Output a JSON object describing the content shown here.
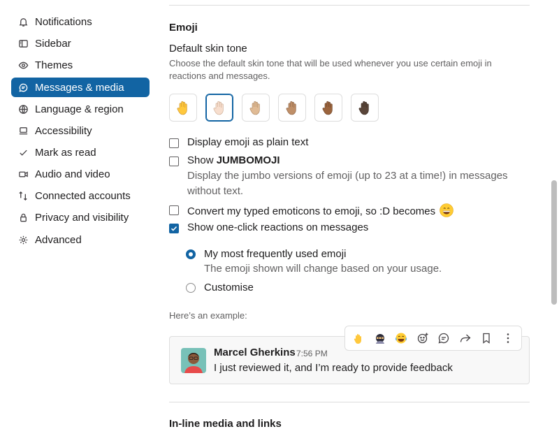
{
  "sidebar": {
    "items": [
      {
        "label": "Notifications",
        "icon": "bell-icon"
      },
      {
        "label": "Sidebar",
        "icon": "sidebar-panel-icon"
      },
      {
        "label": "Themes",
        "icon": "eye-icon"
      },
      {
        "label": "Messages & media",
        "icon": "message-icon",
        "active": true
      },
      {
        "label": "Language & region",
        "icon": "globe-icon"
      },
      {
        "label": "Accessibility",
        "icon": "laptop-icon"
      },
      {
        "label": "Mark as read",
        "icon": "check-icon"
      },
      {
        "label": "Audio and video",
        "icon": "video-icon"
      },
      {
        "label": "Connected accounts",
        "icon": "arrows-icon"
      },
      {
        "label": "Privacy and visibility",
        "icon": "lock-icon"
      },
      {
        "label": "Advanced",
        "icon": "gear-icon"
      }
    ]
  },
  "emoji": {
    "title": "Emoji",
    "skin_tone_heading": "Default skin tone",
    "skin_tone_description": "Choose the default skin tone that will be used whenever you use certain emoji in reactions and messages.",
    "skin_tones": [
      {
        "name": "default",
        "color": "#ffc83d"
      },
      {
        "name": "light",
        "color": "#f7dece",
        "selected": true
      },
      {
        "name": "medium-light",
        "color": "#e0bb95"
      },
      {
        "name": "medium",
        "color": "#bf8f68"
      },
      {
        "name": "medium-dark",
        "color": "#9b643d"
      },
      {
        "name": "dark",
        "color": "#594539"
      }
    ],
    "options": {
      "plain_text": {
        "label": "Display emoji as plain text",
        "checked": false
      },
      "jumbomoji": {
        "label_prefix": "Show ",
        "label_bold": "JUMBOMOJI",
        "checked": false,
        "description": "Display the jumbo versions of emoji (up to 23 at a time!) in messages without text."
      },
      "convert": {
        "label": "Convert my typed emoticons to emoji, so :D becomes",
        "checked": false
      },
      "one_click": {
        "label": "Show one-click reactions on messages",
        "checked": true
      }
    },
    "reaction_mode": {
      "frequent": {
        "label": "My most frequently used emoji",
        "description": "The emoji shown will change based on your usage.",
        "selected": true
      },
      "customise": {
        "label": "Customise",
        "selected": false
      }
    },
    "example_label": "Here’s an example:",
    "example_message": {
      "name": "Marcel Gherkins",
      "time": "7:56 PM",
      "text": "I just reviewed it, and I’m ready to provide feedback"
    },
    "toolbar_icons": [
      "raised-hand-emoji-icon",
      "ninja-emoji-icon",
      "joy-emoji-icon",
      "add-reaction-icon",
      "reply-thread-icon",
      "forward-icon",
      "bookmark-icon",
      "more-actions-icon"
    ]
  },
  "next_section_title": "In-line media and links",
  "colors": {
    "accent": "#1264a3",
    "muted_text": "#616061",
    "border": "#dddddd"
  }
}
